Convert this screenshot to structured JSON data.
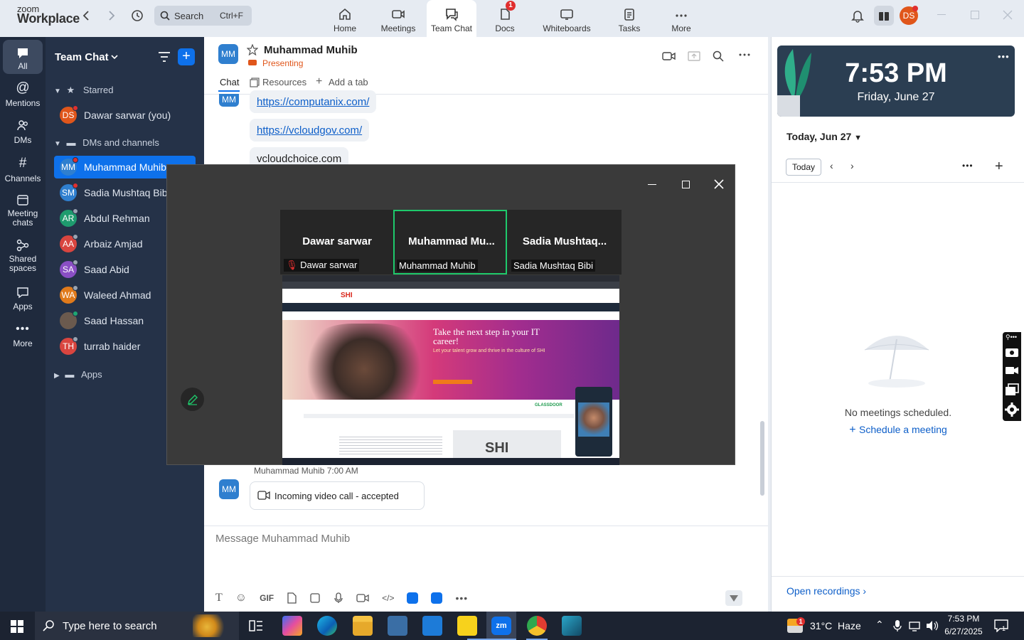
{
  "app": {
    "logo_top": "zoom",
    "logo_bottom": "Workplace"
  },
  "search": {
    "placeholder": "Search",
    "shortcut": "Ctrl+F"
  },
  "tabs": [
    {
      "label": "Home",
      "icon": "home-icon"
    },
    {
      "label": "Meetings",
      "icon": "video-camera-icon"
    },
    {
      "label": "Team Chat",
      "icon": "chat-bubble-icon"
    },
    {
      "label": "Docs",
      "icon": "document-icon",
      "badge": "1"
    },
    {
      "label": "Whiteboards",
      "icon": "whiteboard-icon"
    },
    {
      "label": "Tasks",
      "icon": "tasks-icon"
    },
    {
      "label": "More",
      "icon": "more-dots-icon"
    }
  ],
  "user": {
    "initials": "DS",
    "avatar_color": "#e0561b"
  },
  "rail": [
    {
      "label": "All",
      "icon": "chat-icon"
    },
    {
      "label": "Mentions",
      "icon": "at-icon"
    },
    {
      "label": "DMs",
      "icon": "people-icon"
    },
    {
      "label": "Channels",
      "icon": "hash-icon"
    },
    {
      "label": "Meeting chats",
      "icon": "calendar-icon"
    },
    {
      "label": "Shared spaces",
      "icon": "share-nodes-icon"
    },
    {
      "label": "Apps",
      "icon": "apps-chat-icon"
    },
    {
      "label": "More",
      "icon": "more-dots-icon"
    }
  ],
  "sidebar": {
    "title": "Team Chat",
    "starred_label": "Starred",
    "dms_label": "DMs and channels",
    "apps_label": "Apps",
    "starred": [
      {
        "initials": "DS",
        "name": "Dawar sarwar (you)",
        "color": "#e0561b",
        "status": "#e02f2f"
      }
    ],
    "contacts": [
      {
        "initials": "MM",
        "name": "Muhammad Muhib",
        "color": "#2f7fcf",
        "status": "#e02f2f"
      },
      {
        "initials": "SM",
        "name": "Sadia Mushtaq Bibi",
        "color": "#2f7fcf",
        "status": "#e02f2f"
      },
      {
        "initials": "AR",
        "name": "Abdul Rehman",
        "color": "#1e9b6e",
        "status": "#9aa4b2"
      },
      {
        "initials": "AA",
        "name": "Arbaiz Amjad",
        "color": "#d9453f",
        "status": "#9aa4b2"
      },
      {
        "initials": "SA",
        "name": "Saad Abid",
        "color": "#8a4fc4",
        "status": "#9aa4b2"
      },
      {
        "initials": "WA",
        "name": "Waleed Ahmad",
        "color": "#e07a1b",
        "status": "#9aa4b2"
      },
      {
        "initials": "",
        "name": "Saad Hassan",
        "color": "#6b5a4e",
        "status": "#1ea672"
      },
      {
        "initials": "TH",
        "name": "turrab haider",
        "color": "#d9453f",
        "status": "#9aa4b2"
      }
    ]
  },
  "chat": {
    "header_initials": "MM",
    "header_name": "Muhammad Muhib",
    "status": "Presenting",
    "tab_chat": "Chat",
    "tab_resources": "Resources",
    "tab_add": "Add a tab",
    "links": [
      "https://computanix.com/",
      "https://vcloudgov.com/",
      "vcloudchoice.com"
    ],
    "msg_sender_time": "Muhammad Muhib 7:00 AM",
    "msg_text": "Incoming video call - accepted",
    "composer_placeholder": "Message Muhammad Muhib",
    "composer_tools": [
      "GIF"
    ]
  },
  "popup": {
    "participants": [
      {
        "big": "Dawar sarwar",
        "small": "Dawar sarwar",
        "muted": true
      },
      {
        "big": "Muhammad  Mu...",
        "small": "Muhammad Muhib",
        "active": true
      },
      {
        "big": "Sadia  Mushtaq...",
        "small": "Sadia Mushtaq Bibi"
      }
    ],
    "shared_screen": {
      "brand": "SHI",
      "headline": "Take the next step in your IT career!",
      "subhead": "Let your talent grow and thrive in the culture of SHI",
      "badge": "GLASSDOOR"
    }
  },
  "calendar": {
    "time": "7:53 PM",
    "date": "Friday, June 27",
    "today_label": "Today, Jun 27",
    "today_button": "Today",
    "empty_text": "No meetings scheduled.",
    "schedule_link": "Schedule a meeting",
    "open_recordings": "Open recordings"
  },
  "taskbar": {
    "search_placeholder": "Type here to search",
    "weather": "31°C  Haze",
    "weather_badge": "1",
    "time": "7:53 PM",
    "date": "6/27/2025",
    "notif_count": "1"
  }
}
